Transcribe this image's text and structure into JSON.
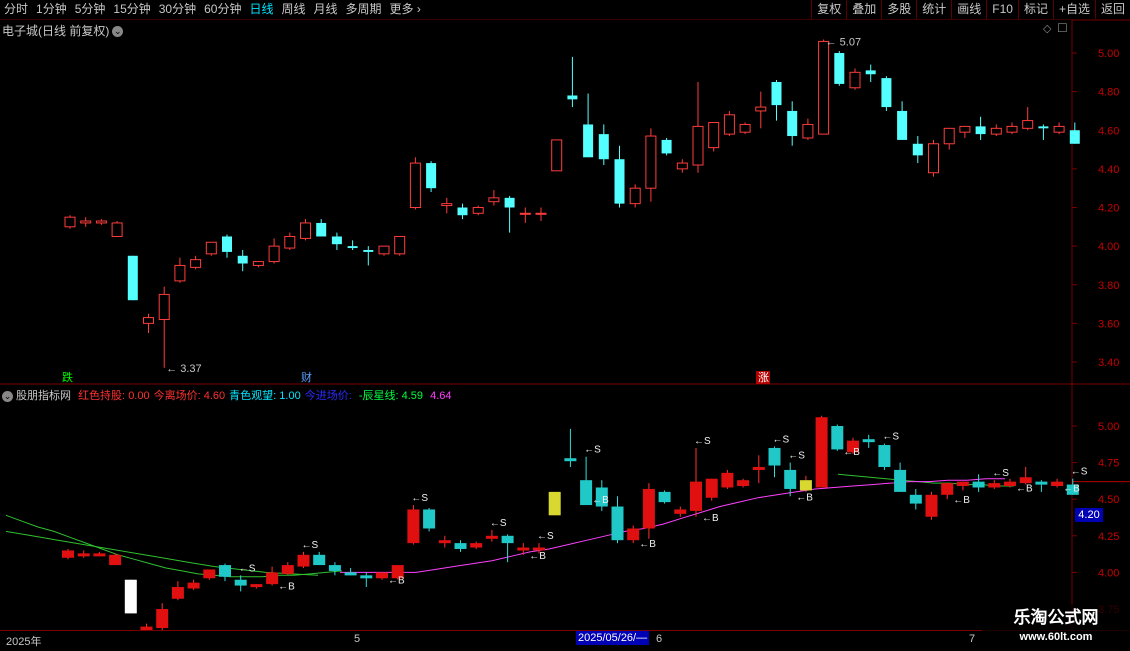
{
  "toolbar": {
    "periods": [
      "分时",
      "1分钟",
      "5分钟",
      "15分钟",
      "30分钟",
      "60分钟",
      "日线",
      "周线",
      "月线",
      "多周期"
    ],
    "active_period": "日线",
    "more": "更多",
    "right": [
      "复权",
      "叠加",
      "多股",
      "统计",
      "画线",
      "F10",
      "标记",
      "+自选",
      "返回"
    ]
  },
  "main": {
    "title": "电子城(日线 前复权)",
    "y_ticks": [
      "5.00",
      "4.80",
      "4.60",
      "4.40",
      "4.20",
      "4.00",
      "3.80",
      "3.60",
      "3.40"
    ],
    "high_label": "5.07",
    "low_label": "3.37",
    "markers": [
      "跌",
      "财",
      "涨"
    ]
  },
  "indicator": {
    "name": "股朋指标网",
    "fields": [
      {
        "label": "红色持股:",
        "value": "0.00",
        "color": "#ff3030"
      },
      {
        "label": "今离场价:",
        "value": "4.60",
        "color": "#ff3030"
      },
      {
        "label": "青色观望:",
        "value": "1.00",
        "color": "#00e5ff"
      },
      {
        "label": "今进场价:",
        "value": "",
        "color": "#2a2aff"
      },
      {
        "label": "-辰星线:",
        "value": "4.59",
        "color": "#00ff40"
      },
      {
        "label": "",
        "value": "4.64",
        "color": "#ff40ff"
      }
    ],
    "y_ticks": [
      "5.00",
      "4.75",
      "4.50",
      "4.25",
      "4.00",
      "3.75"
    ],
    "price_box": "4.20",
    "buy_label": "B",
    "sell_label": "S"
  },
  "dates": {
    "d1": "2025年",
    "d2": "5",
    "d3": "2025/05/26/—",
    "d4": "6",
    "d5": "7"
  },
  "watermark": {
    "line1": "乐淘公式网",
    "line2": "www.60lt.com"
  },
  "chart_data": {
    "type": "candlestick",
    "title": "电子城(日线 前复权)",
    "ylim": [
      3.3,
      5.1
    ],
    "candles": [
      {
        "o": 4.1,
        "h": 4.16,
        "l": 4.09,
        "c": 4.15
      },
      {
        "o": 4.12,
        "h": 4.15,
        "l": 4.1,
        "c": 4.13
      },
      {
        "o": 4.12,
        "h": 4.14,
        "l": 4.11,
        "c": 4.13
      },
      {
        "o": 4.05,
        "h": 4.13,
        "l": 4.05,
        "c": 4.12
      },
      {
        "o": 3.95,
        "h": 3.95,
        "l": 3.72,
        "c": 3.72
      },
      {
        "o": 3.6,
        "h": 3.65,
        "l": 3.55,
        "c": 3.63
      },
      {
        "o": 3.62,
        "h": 3.79,
        "l": 3.37,
        "c": 3.75
      },
      {
        "o": 3.82,
        "h": 3.94,
        "l": 3.81,
        "c": 3.9
      },
      {
        "o": 3.89,
        "h": 3.95,
        "l": 3.88,
        "c": 3.93
      },
      {
        "o": 3.96,
        "h": 4.01,
        "l": 3.95,
        "c": 4.02
      },
      {
        "o": 4.05,
        "h": 4.06,
        "l": 3.94,
        "c": 3.97
      },
      {
        "o": 3.95,
        "h": 3.98,
        "l": 3.87,
        "c": 3.91
      },
      {
        "o": 3.9,
        "h": 3.92,
        "l": 3.89,
        "c": 3.92
      },
      {
        "o": 3.92,
        "h": 4.04,
        "l": 3.91,
        "c": 4.0
      },
      {
        "o": 3.99,
        "h": 4.07,
        "l": 3.98,
        "c": 4.05
      },
      {
        "o": 4.04,
        "h": 4.14,
        "l": 4.03,
        "c": 4.12
      },
      {
        "o": 4.12,
        "h": 4.14,
        "l": 4.05,
        "c": 4.05
      },
      {
        "o": 4.05,
        "h": 4.07,
        "l": 3.98,
        "c": 4.01
      },
      {
        "o": 4.0,
        "h": 4.03,
        "l": 3.98,
        "c": 3.99
      },
      {
        "o": 3.98,
        "h": 4.0,
        "l": 3.9,
        "c": 3.97
      },
      {
        "o": 3.96,
        "h": 4.0,
        "l": 3.95,
        "c": 4.0
      },
      {
        "o": 3.96,
        "h": 4.05,
        "l": 3.95,
        "c": 4.05
      },
      {
        "o": 4.2,
        "h": 4.46,
        "l": 4.19,
        "c": 4.43
      },
      {
        "o": 4.43,
        "h": 4.44,
        "l": 4.28,
        "c": 4.3
      },
      {
        "o": 4.21,
        "h": 4.25,
        "l": 4.17,
        "c": 4.22
      },
      {
        "o": 4.2,
        "h": 4.22,
        "l": 4.14,
        "c": 4.16
      },
      {
        "o": 4.17,
        "h": 4.21,
        "l": 4.16,
        "c": 4.2
      },
      {
        "o": 4.23,
        "h": 4.29,
        "l": 4.21,
        "c": 4.25
      },
      {
        "o": 4.25,
        "h": 4.26,
        "l": 4.07,
        "c": 4.2
      },
      {
        "o": 4.17,
        "h": 4.2,
        "l": 4.12,
        "c": 4.17
      },
      {
        "o": 4.17,
        "h": 4.2,
        "l": 4.13,
        "c": 4.17
      },
      {
        "o": 4.39,
        "h": 4.55,
        "l": 4.39,
        "c": 4.55
      },
      {
        "o": 4.78,
        "h": 4.98,
        "l": 4.72,
        "c": 4.76
      },
      {
        "o": 4.63,
        "h": 4.79,
        "l": 4.5,
        "c": 4.46
      },
      {
        "o": 4.58,
        "h": 4.63,
        "l": 4.42,
        "c": 4.45
      },
      {
        "o": 4.45,
        "h": 4.52,
        "l": 4.2,
        "c": 4.22
      },
      {
        "o": 4.22,
        "h": 4.32,
        "l": 4.2,
        "c": 4.3
      },
      {
        "o": 4.3,
        "h": 4.61,
        "l": 4.23,
        "c": 4.57
      },
      {
        "o": 4.55,
        "h": 4.56,
        "l": 4.47,
        "c": 4.48
      },
      {
        "o": 4.4,
        "h": 4.45,
        "l": 4.38,
        "c": 4.43
      },
      {
        "o": 4.42,
        "h": 4.85,
        "l": 4.38,
        "c": 4.62
      },
      {
        "o": 4.51,
        "h": 4.64,
        "l": 4.49,
        "c": 4.64
      },
      {
        "o": 4.58,
        "h": 4.7,
        "l": 4.57,
        "c": 4.68
      },
      {
        "o": 4.59,
        "h": 4.64,
        "l": 4.58,
        "c": 4.63
      },
      {
        "o": 4.7,
        "h": 4.8,
        "l": 4.61,
        "c": 4.72
      },
      {
        "o": 4.85,
        "h": 4.86,
        "l": 4.65,
        "c": 4.73
      },
      {
        "o": 4.7,
        "h": 4.75,
        "l": 4.52,
        "c": 4.57
      },
      {
        "o": 4.56,
        "h": 4.66,
        "l": 4.55,
        "c": 4.63
      },
      {
        "o": 4.58,
        "h": 5.07,
        "l": 4.58,
        "c": 5.06
      },
      {
        "o": 5.0,
        "h": 5.01,
        "l": 4.83,
        "c": 4.84
      },
      {
        "o": 4.82,
        "h": 4.92,
        "l": 4.81,
        "c": 4.9
      },
      {
        "o": 4.91,
        "h": 4.94,
        "l": 4.85,
        "c": 4.89
      },
      {
        "o": 4.87,
        "h": 4.88,
        "l": 4.7,
        "c": 4.72
      },
      {
        "o": 4.7,
        "h": 4.75,
        "l": 4.55,
        "c": 4.55
      },
      {
        "o": 4.53,
        "h": 4.57,
        "l": 4.43,
        "c": 4.47
      },
      {
        "o": 4.38,
        "h": 4.55,
        "l": 4.36,
        "c": 4.53
      },
      {
        "o": 4.53,
        "h": 4.61,
        "l": 4.5,
        "c": 4.61
      },
      {
        "o": 4.59,
        "h": 4.62,
        "l": 4.56,
        "c": 4.62
      },
      {
        "o": 4.62,
        "h": 4.67,
        "l": 4.55,
        "c": 4.58
      },
      {
        "o": 4.58,
        "h": 4.63,
        "l": 4.57,
        "c": 4.61
      },
      {
        "o": 4.59,
        "h": 4.64,
        "l": 4.58,
        "c": 4.62
      },
      {
        "o": 4.61,
        "h": 4.72,
        "l": 4.6,
        "c": 4.65
      },
      {
        "o": 4.62,
        "h": 4.63,
        "l": 4.55,
        "c": 4.61
      },
      {
        "o": 4.59,
        "h": 4.64,
        "l": 4.58,
        "c": 4.62
      },
      {
        "o": 4.6,
        "h": 4.64,
        "l": 4.53,
        "c": 4.53
      }
    ],
    "indicator": {
      "ylim": [
        3.65,
        5.15
      ],
      "magenta_line": [
        4.0,
        4.0,
        4.0,
        4.0,
        4.0,
        4.02,
        4.04,
        4.06,
        4.08,
        4.11,
        4.14,
        4.16,
        4.19,
        4.22,
        4.25,
        4.28,
        4.3,
        4.33,
        4.37,
        4.41,
        4.45,
        4.48,
        4.51,
        4.53,
        4.55,
        4.57,
        4.58,
        4.59,
        4.6,
        4.61,
        4.62,
        4.62,
        4.63,
        4.63,
        4.64,
        4.64
      ],
      "green_line": [
        4.39,
        4.35,
        4.31,
        4.28,
        4.24,
        4.2,
        4.16,
        4.12,
        4.09,
        4.06,
        4.03,
        4.01,
        3.99,
        3.98,
        3.97,
        3.97,
        3.97,
        3.98,
        3.98,
        3.99,
        4.0,
        4.01
      ],
      "green_line2": [
        4.67,
        4.66,
        4.65,
        4.64,
        4.63,
        4.62,
        4.61,
        4.61,
        4.6,
        4.6,
        4.59,
        4.59
      ],
      "buy_idx": [
        6,
        13,
        20,
        29,
        33,
        36,
        40,
        46,
        49,
        56,
        60,
        63
      ],
      "sell_idx": [
        11,
        15,
        22,
        27,
        30,
        33,
        40,
        45,
        46,
        52,
        59,
        64
      ]
    }
  }
}
